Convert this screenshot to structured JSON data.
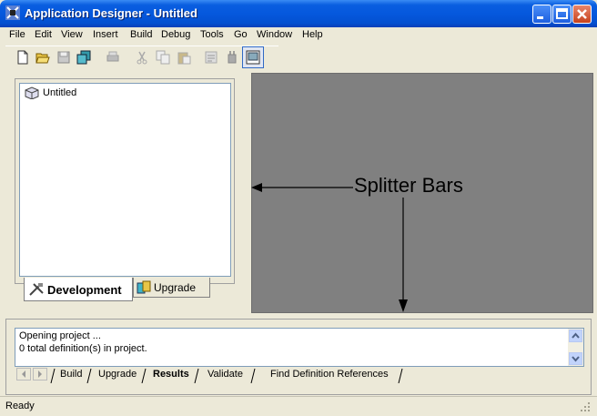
{
  "window": {
    "title": "Application Designer - Untitled",
    "controls": [
      "minimize-icon",
      "maximize-icon",
      "close-icon"
    ]
  },
  "menu": {
    "items": [
      "File",
      "Edit",
      "View",
      "Insert",
      "Build",
      "Debug",
      "Tools",
      "Go",
      "Window",
      "Help"
    ]
  },
  "toolbar": {
    "icons": [
      "new-icon",
      "open-icon",
      "save-icon",
      "save-all-icon",
      "print-icon",
      "cut-icon",
      "copy-icon",
      "paste-icon",
      "properties-icon",
      "plug-icon",
      "project-icon"
    ]
  },
  "project_tree": {
    "items": [
      {
        "label": "Untitled",
        "icon": "project-icon"
      }
    ]
  },
  "left_tabs": [
    {
      "label": "Development",
      "icon": "tools-icon",
      "active": true
    },
    {
      "label": "Upgrade",
      "icon": "upgrade-icon",
      "active": false
    }
  ],
  "annotation": {
    "label": "Splitter Bars"
  },
  "output": {
    "lines": [
      "Opening project ...",
      "0  total definition(s) in project."
    ]
  },
  "output_tabs": [
    "Build",
    "Upgrade",
    "Results",
    "Validate",
    "Find Definition References"
  ],
  "output_active_tab": "Results",
  "status": {
    "text": "Ready"
  },
  "colors": {
    "titlebar": "#0558dd",
    "window_bg": "#ece9d8",
    "workspace": "#808080"
  }
}
